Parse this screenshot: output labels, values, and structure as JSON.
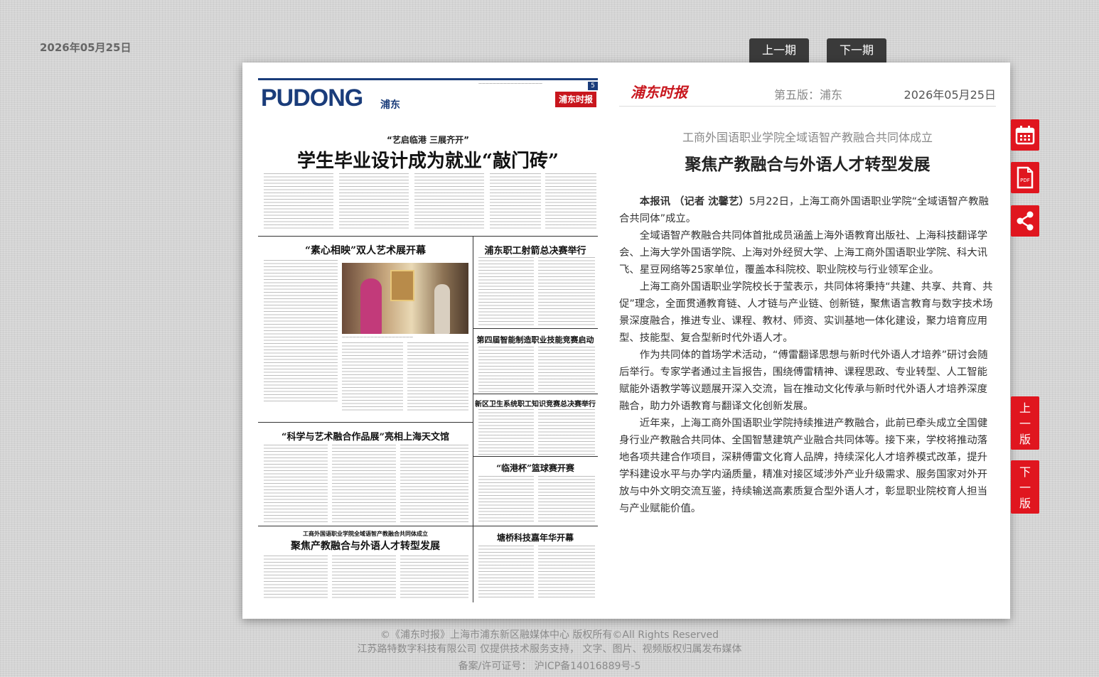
{
  "top_date": "2026年05月25日",
  "nav": {
    "prev": "上一期",
    "next": "下一期"
  },
  "newspaper": {
    "masthead_en": "PUDONG",
    "masthead_cn": "浦东",
    "page_number": "5",
    "logo": "浦东时报",
    "kicker": "“艺启临港 三展齐开”",
    "headline": "学生毕业设计成为就业“敲门砖”",
    "sub1": "“素心相映”双人艺术展开幕",
    "sub2": "浦东职工射箭总决赛举行",
    "sub3": "第四届智能制造职业技能竞赛启动",
    "sub4": "新区卫生系统职工知识竞赛总决赛举行",
    "sub5": "“科学与艺术融合作品展”亮相上海天文馆",
    "sub6": "“临港杯”篮球赛开赛",
    "sub7_kicker": "工商外国语职业学院全域语智产教融合共同体成立",
    "sub7": "聚焦产教融合与外语人才转型发展",
    "sub8": "塘桥科技嘉年华开幕"
  },
  "article": {
    "logo": "浦东时报",
    "edition": "第五版：浦东",
    "date": "2026年05月25日",
    "pretitle": "工商外国语职业学院全域语智产教融合共同体成立",
    "title": "聚焦产教融合与外语人才转型发展",
    "lead": "本报讯 （记者 沈馨艺）",
    "p1": "5月22日，上海工商外国语职业学院“全域语智产教融合共同体”成立。",
    "p2": "全域语智产教融合共同体首批成员涵盖上海外语教育出版社、上海科技翻译学会、上海大学外国语学院、上海对外经贸大学、上海工商外国语职业学院、科大讯飞、星豆网络等25家单位，覆盖本科院校、职业院校与行业领军企业。",
    "p3": "上海工商外国语职业学院校长于莹表示，共同体将秉持“共建、共享、共育、共促”理念，全面贯通教育链、人才链与产业链、创新链，聚焦语言教育与数字技术场景深度融合，推进专业、课程、教材、师资、实训基地一体化建设，聚力培育应用型、技能型、复合型新时代外语人才。",
    "p4": "作为共同体的首场学术活动，“傅雷翻译思想与新时代外语人才培养”研讨会随后举行。专家学者通过主旨报告，围绕傅雷精神、课程思政、专业转型、人工智能赋能外语教学等议题展开深入交流，旨在推动文化传承与新时代外语人才培养深度融合，助力外语教育与翻译文化创新发展。",
    "p5": "近年来，上海工商外国语职业学院持续推进产教融合，此前已牵头成立全国健身行业产教融合共同体、全国智慧建筑产业融合共同体等。接下来，学校将推动落地各项共建合作项目，深耕傅雷文化育人品牌，持续深化人才培养模式改革，提升学科建设水平与办学内涵质量，精准对接区域涉外产业升级需求、服务国家对外开放与中外文明交流互鉴，持续输送高素质复合型外语人才，彰显职业院校育人担当与产业赋能价值。"
  },
  "side": {
    "calendar_icon": "calendar-icon",
    "pdf_icon": "pdf-icon",
    "pdf_label": "PDF",
    "share_icon": "share-icon",
    "prev_page": "上一版",
    "next_page": "下一版"
  },
  "footer": {
    "line1": "©《浦东时报》上海市浦东新区融媒体中心 版权所有©All Rights Reserved",
    "line2": "江苏路特数字科技有限公司 仅提供技术服务支持， 文字、图片、视频版权归属发布媒体",
    "line3": "备案/许可证号： 沪ICP备14016889号-5"
  },
  "colors": {
    "accent_red": "#e0161f",
    "masthead_blue": "#1a3c7a",
    "nav_dark": "#3a3a3a"
  }
}
